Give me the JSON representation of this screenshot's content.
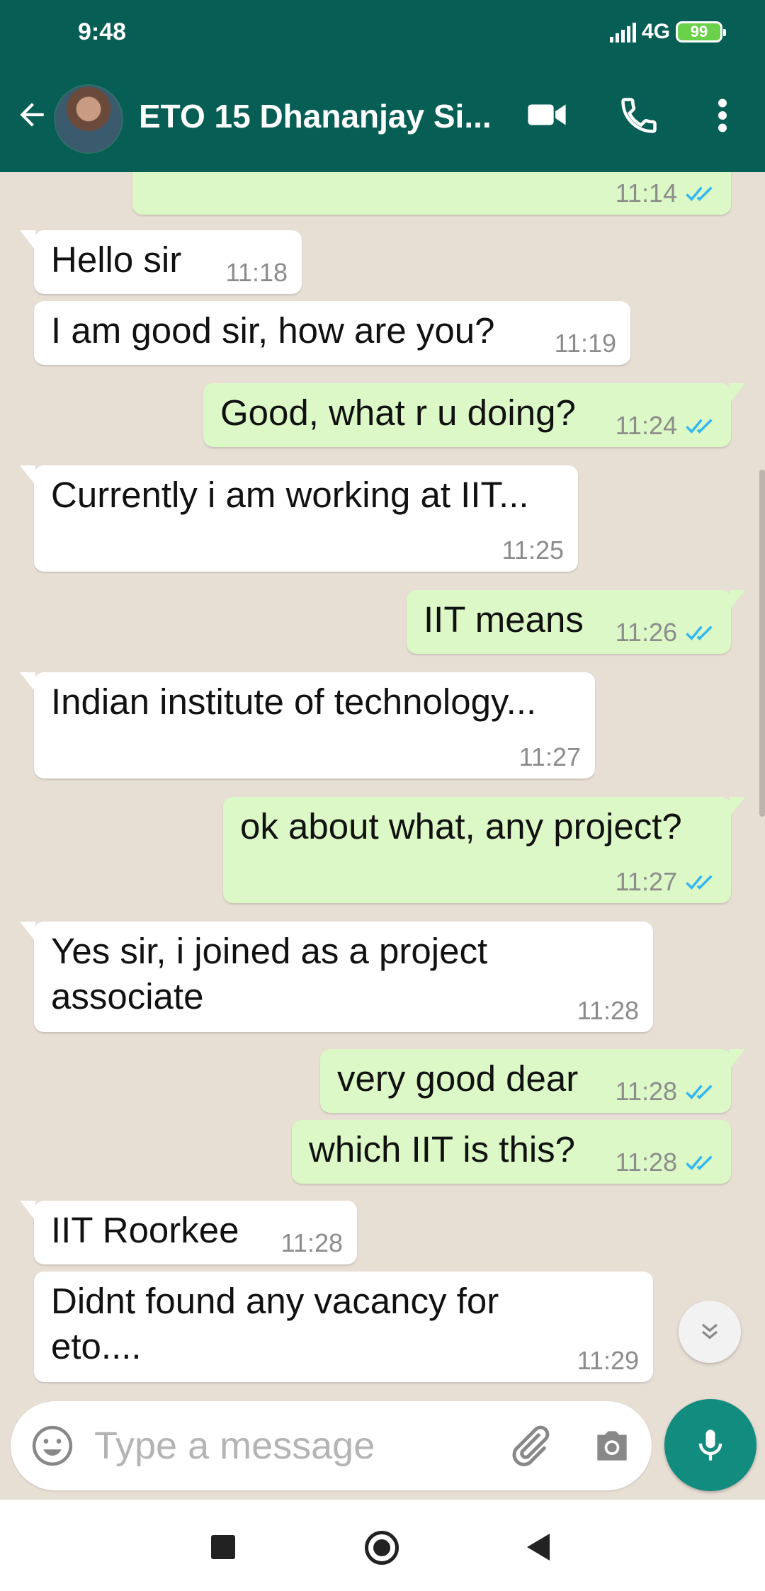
{
  "status_bar": {
    "time": "9:48",
    "network": "4G",
    "battery": "99"
  },
  "header": {
    "title": "ETO 15 Dhananjay Si...",
    "avatar": "contact-avatar"
  },
  "messages": [
    {
      "dir": "out",
      "text": "",
      "time": "11:14",
      "read": true
    },
    {
      "dir": "in",
      "text": "Hello sir",
      "time": "11:18"
    },
    {
      "dir": "in",
      "text": "I am good sir, how are you?",
      "time": "11:19"
    },
    {
      "dir": "out",
      "text": "Good, what r u doing?",
      "time": "11:24",
      "read": true
    },
    {
      "dir": "in",
      "text": "Currently i am working at IIT...",
      "time": "11:25"
    },
    {
      "dir": "out",
      "text": "IIT means",
      "time": "11:26",
      "read": true
    },
    {
      "dir": "in",
      "text": "Indian institute of technology...",
      "time": "11:27"
    },
    {
      "dir": "out",
      "text": "ok about what, any project?",
      "time": "11:27",
      "read": true
    },
    {
      "dir": "in",
      "text_line1": "Yes sir, i joined as a project",
      "text_line2": "associate",
      "time": "11:28"
    },
    {
      "dir": "out",
      "text": "very good dear",
      "time": "11:28",
      "read": true
    },
    {
      "dir": "out",
      "text": "which IIT is this?",
      "time": "11:28",
      "read": true
    },
    {
      "dir": "in",
      "text": "IIT Roorkee",
      "time": "11:28"
    },
    {
      "dir": "in",
      "text_line1": "Didnt found any vacancy for",
      "text_line2": "eto....",
      "time": "11:29"
    }
  ],
  "composer": {
    "placeholder": "Type a message"
  },
  "colors": {
    "header": "#075e54",
    "outgoing": "#dcf8c6",
    "incoming": "#ffffff",
    "mic": "#128c7e",
    "read_ticks": "#34b7f1"
  }
}
